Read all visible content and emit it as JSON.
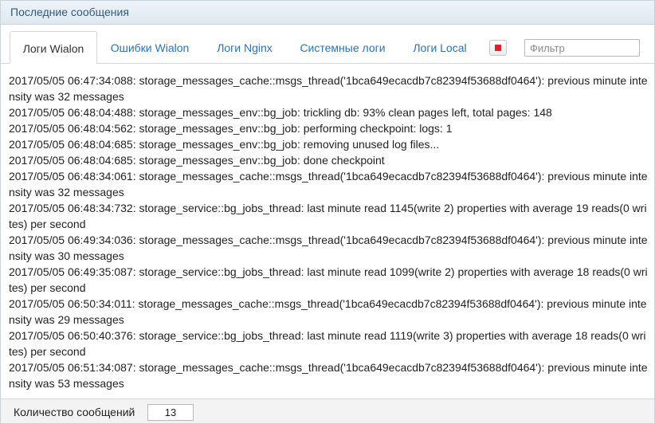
{
  "header": {
    "title": "Последние сообщения"
  },
  "tabs": [
    {
      "label": "Логи Wialon",
      "active": true
    },
    {
      "label": "Ошибки Wialon",
      "active": false
    },
    {
      "label": "Логи Nginx",
      "active": false
    },
    {
      "label": "Системные логи",
      "active": false
    },
    {
      "label": "Логи Local",
      "active": false
    }
  ],
  "toolbar": {
    "stop_icon": "stop-icon",
    "stop_color": "#d9232c",
    "filter_placeholder": "Фильтр",
    "filter_value": ""
  },
  "log_lines": [
    "2017/05/05 06:47:34:088: storage_messages_cache::msgs_thread('1bca649ecacdb7c82394f53688df0464'): previous minute intensity was 32 messages",
    "2017/05/05 06:48:04:488: storage_messages_env::bg_job: trickling db: 93% clean pages left, total pages: 148",
    "2017/05/05 06:48:04:562: storage_messages_env::bg_job: performing checkpoint: logs: 1",
    "2017/05/05 06:48:04:685: storage_messages_env::bg_job: removing unused log files...",
    "2017/05/05 06:48:04:685: storage_messages_env::bg_job: done checkpoint",
    "2017/05/05 06:48:34:061: storage_messages_cache::msgs_thread('1bca649ecacdb7c82394f53688df0464'): previous minute intensity was 32 messages",
    "2017/05/05 06:48:34:732: storage_service::bg_jobs_thread: last minute read 1145(write 2) properties with average 19 reads(0 writes) per second",
    "2017/05/05 06:49:34:036: storage_messages_cache::msgs_thread('1bca649ecacdb7c82394f53688df0464'): previous minute intensity was 30 messages",
    "2017/05/05 06:49:35:087: storage_service::bg_jobs_thread: last minute read 1099(write 2) properties with average 18 reads(0 writes) per second",
    "2017/05/05 06:50:34:011: storage_messages_cache::msgs_thread('1bca649ecacdb7c82394f53688df0464'): previous minute intensity was 29 messages",
    "2017/05/05 06:50:40:376: storage_service::bg_jobs_thread: last minute read 1119(write 3) properties with average 18 reads(0 writes) per second",
    "2017/05/05 06:51:34:087: storage_messages_cache::msgs_thread('1bca649ecacdb7c82394f53688df0464'): previous minute intensity was 53 messages"
  ],
  "footer": {
    "count_label": "Количество сообщений",
    "count_value": "13"
  }
}
